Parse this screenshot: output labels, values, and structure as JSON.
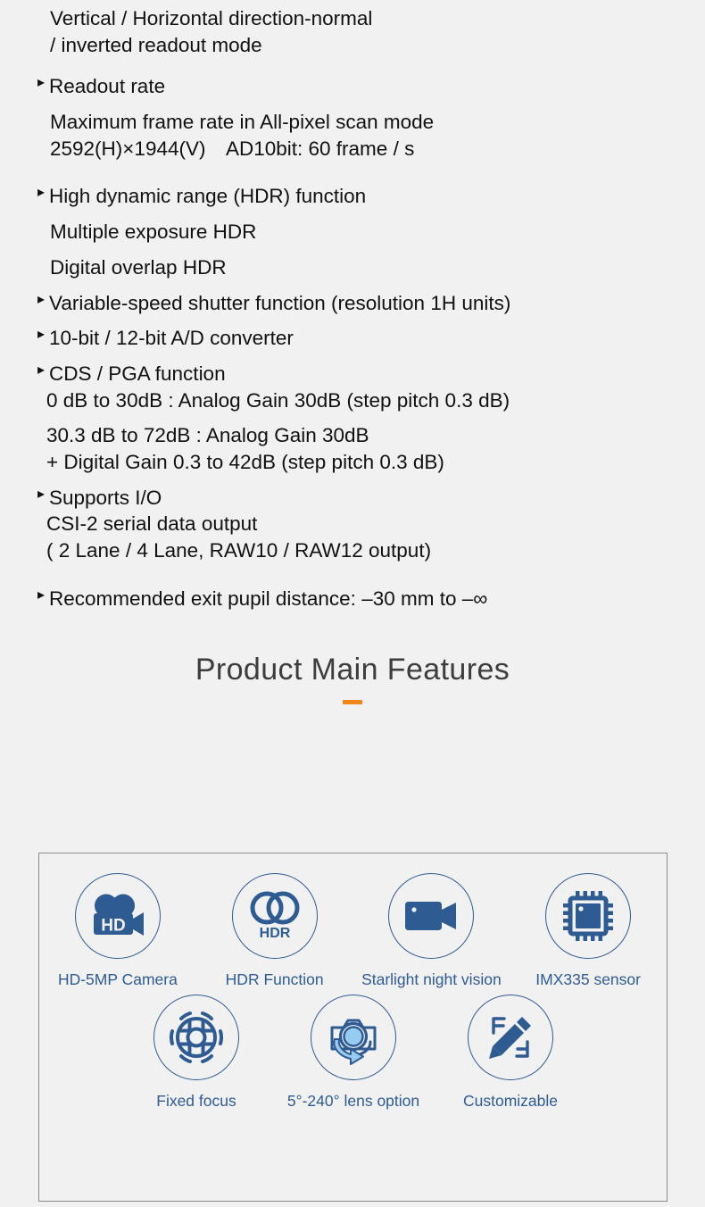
{
  "spec": {
    "lines": [
      {
        "type": "plain",
        "text": "Vertical / Horizontal direction-normal"
      },
      {
        "type": "plain",
        "text": "/ inverted readout mode"
      },
      {
        "type": "gap-md"
      },
      {
        "type": "bullet",
        "text": "Readout rate"
      },
      {
        "type": "gap-sm"
      },
      {
        "type": "plain",
        "text": "Maximum frame rate in All-pixel scan mode"
      },
      {
        "type": "plain",
        "text": "2592(H)×1944(V) AD10bit: 60 frame / s"
      },
      {
        "type": "gap-lg"
      },
      {
        "type": "bullet",
        "text": "High dynamic range (HDR) function"
      },
      {
        "type": "gap-sm"
      },
      {
        "type": "plain",
        "text": "Multiple exposure HDR"
      },
      {
        "type": "gap-sm"
      },
      {
        "type": "plain",
        "text": "Digital overlap HDR"
      },
      {
        "type": "gap-sm"
      },
      {
        "type": "bullet",
        "text": "Variable-speed shutter function (resolution 1H units)"
      },
      {
        "type": "gap-sm"
      },
      {
        "type": "bullet",
        "text": "10-bit / 12-bit A/D converter"
      },
      {
        "type": "gap-sm"
      },
      {
        "type": "bullet",
        "text": "CDS / PGA function"
      },
      {
        "type": "plain-narrow",
        "text": "0 dB to 30dB : Analog Gain 30dB (step pitch 0.3 dB)"
      },
      {
        "type": "gap-sm"
      },
      {
        "type": "plain-narrow",
        "text": "30.3 dB to 72dB : Analog Gain 30dB"
      },
      {
        "type": "plain-narrow",
        "text": "+ Digital Gain 0.3 to 42dB (step pitch 0.3 dB)"
      },
      {
        "type": "gap-sm"
      },
      {
        "type": "bullet",
        "text": "Supports I/O"
      },
      {
        "type": "plain-narrow",
        "text": "CSI-2 serial data output"
      },
      {
        "type": "plain-narrow",
        "text": "( 2 Lane / 4 Lane, RAW10 / RAW12 output)"
      },
      {
        "type": "gap-lg"
      },
      {
        "type": "bullet",
        "text": "Recommended exit pupil distance: –30 mm to –∞"
      }
    ],
    "bullet_glyph": "▸"
  },
  "section": {
    "title": "Product Main Features",
    "underline_color": "#f08519"
  },
  "features": {
    "accent_color": "#2f5b93",
    "accent_light_color": "#97cbef",
    "rows": [
      [
        {
          "icon": "hd-camera-icon",
          "label": "HD-5MP Camera",
          "icon_text": "HD"
        },
        {
          "icon": "hdr-circles-icon",
          "label": "HDR Function",
          "icon_text": "HDR"
        },
        {
          "icon": "night-vision-icon",
          "label": "Starlight night vision"
        },
        {
          "icon": "sensor-chip-icon",
          "label": "IMX335 sensor"
        }
      ],
      [
        {
          "icon": "focus-ring-icon",
          "label": "Fixed focus"
        },
        {
          "icon": "lens-rotate-icon",
          "label": "5°-240° lens option"
        },
        {
          "icon": "pencil-edit-icon",
          "label": "Customizable"
        }
      ]
    ]
  }
}
